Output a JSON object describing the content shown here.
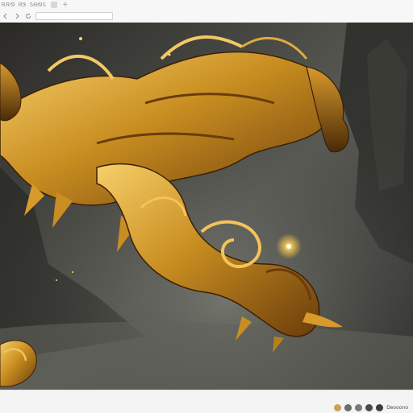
{
  "browser": {
    "tab_title": "ᎡᎡᏫ ᏒᏕ ᏚᎾᏫᏚ",
    "new_tab_symbol": "+",
    "address": ""
  },
  "icons": {
    "back": "arrow-left-icon",
    "forward": "arrow-right-icon",
    "reload": "reload-icon"
  },
  "tray": {
    "items": [
      "app-icon",
      "app-icon",
      "app-icon",
      "app-icon",
      "app-icon"
    ],
    "text": "Deooono"
  },
  "colors": {
    "gold": "#c98e21",
    "gold_light": "#f4c35a",
    "mist": "#5c5d57",
    "dark": "#1e1d1a"
  }
}
